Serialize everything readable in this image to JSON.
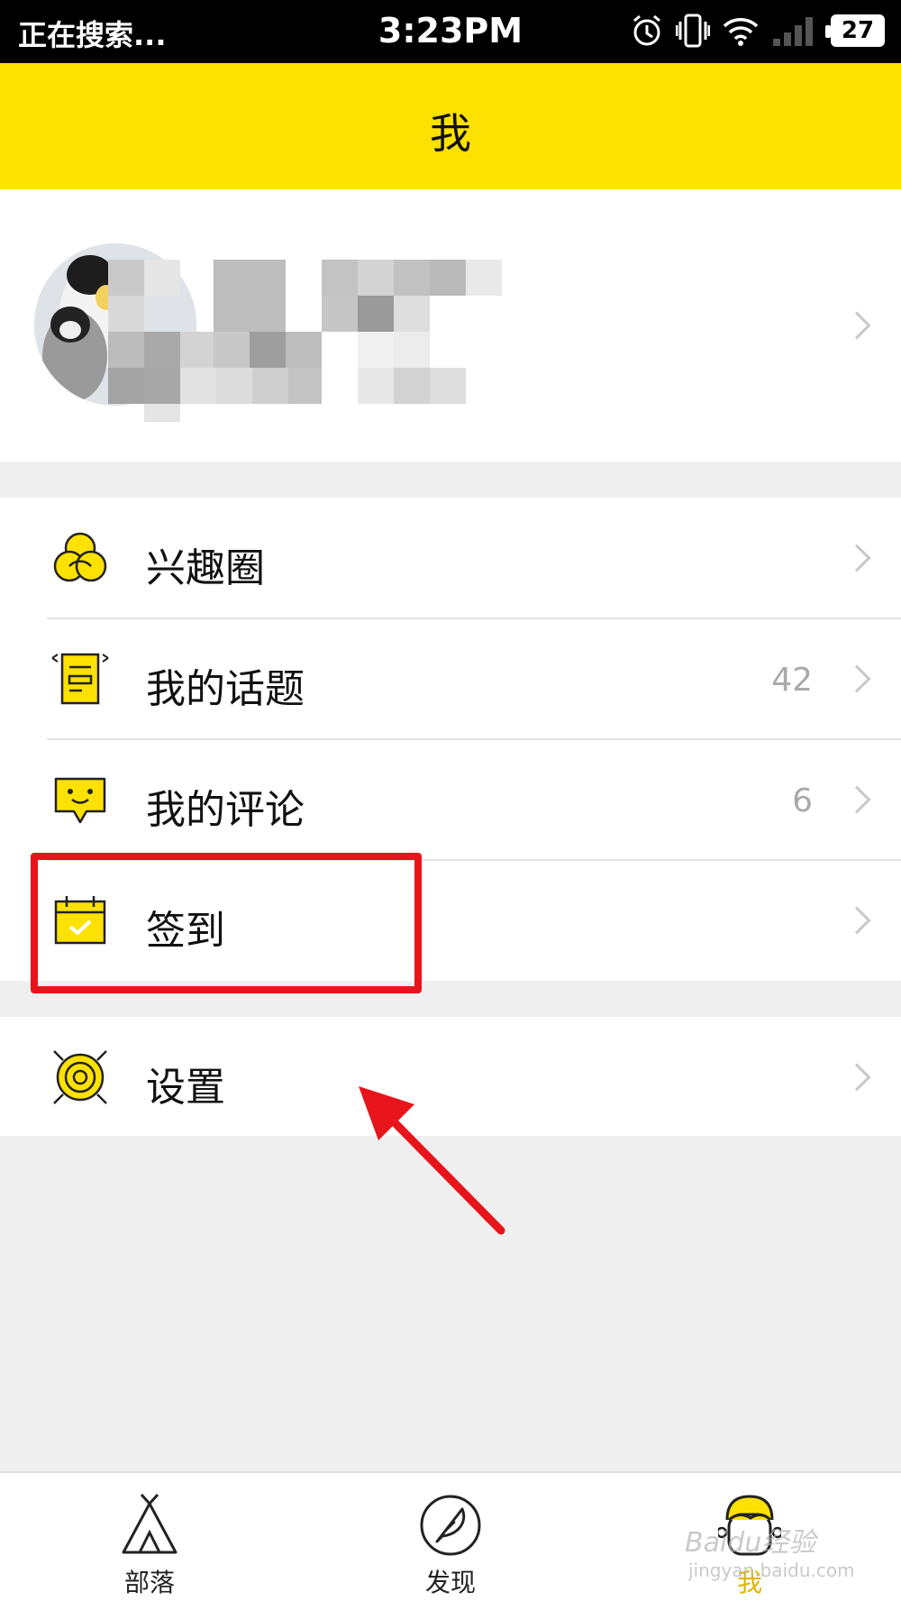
{
  "status_bar": {
    "carrier_text": "正在搜索...",
    "time": "3:23PM",
    "battery": "27",
    "icons": [
      "alarm-icon",
      "vibrate-icon",
      "wifi-icon",
      "signal-icon",
      "battery-icon"
    ]
  },
  "header": {
    "title": "我"
  },
  "menu": {
    "group1": [
      {
        "label": "兴趣圈",
        "icon": "interest-circle-icon"
      },
      {
        "label": "我的话题",
        "count": "42",
        "icon": "topic-icon"
      },
      {
        "label": "我的评论",
        "count": "6",
        "icon": "comment-icon"
      },
      {
        "label": "签到",
        "icon": "checkin-calendar-icon"
      }
    ],
    "group2": [
      {
        "label": "设置",
        "icon": "settings-target-icon"
      }
    ]
  },
  "tabbar": {
    "tabs": [
      {
        "label": "部落",
        "icon": "tent-icon"
      },
      {
        "label": "发现",
        "icon": "feather-icon"
      },
      {
        "label": "我",
        "icon": "face-icon",
        "active": true
      }
    ]
  },
  "colors": {
    "accent": "#fde100",
    "annotation": "#e8141b",
    "active_tab": "#e0b400"
  },
  "watermark": {
    "text": "Baidu经验",
    "sub": "jingyan.baidu.com"
  }
}
